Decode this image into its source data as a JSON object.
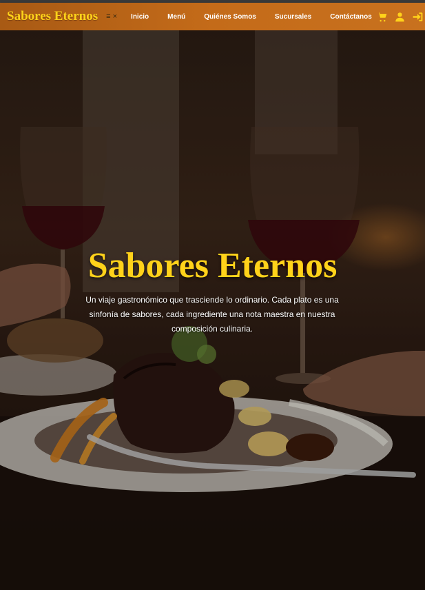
{
  "header": {
    "brand": "Sabores Eternos",
    "toggle_icons": "≡ ×",
    "nav": [
      {
        "label": "Inicio"
      },
      {
        "label": "Menú"
      },
      {
        "label": "Quiénes Somos"
      },
      {
        "label": "Sucursales"
      },
      {
        "label": "Contáctanos"
      }
    ],
    "icons": [
      "cart-icon",
      "user-icon",
      "sign-in-icon"
    ],
    "colors": {
      "bar": "#c46b19",
      "accent": "#ffd21a"
    }
  },
  "hero": {
    "title": "Sabores Eternos",
    "description": "Un viaje gastronómico que trasciende lo ordinario. Cada plato es una sinfonía de sabores, cada ingrediente una nota maestra en nuestra composición culinaria."
  }
}
